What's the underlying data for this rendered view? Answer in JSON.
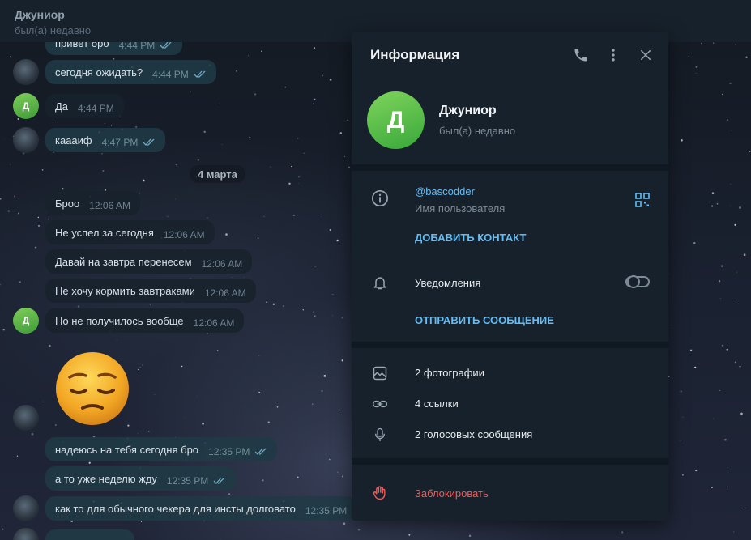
{
  "chat": {
    "title": "Джуниор",
    "status": "был(а) недавно"
  },
  "messages": [
    {
      "text": "привет бро",
      "time": "4:44 PM",
      "dir": "out"
    },
    {
      "text": "сегодня ожидать?",
      "time": "4:44 PM",
      "dir": "out"
    },
    {
      "text": "Да",
      "time": "4:44 PM",
      "dir": "in"
    },
    {
      "text": "каааиф",
      "time": "4:47 PM",
      "dir": "out"
    },
    {
      "text": "Броо",
      "time": "12:06 AM",
      "dir": "in"
    },
    {
      "text": "Не успел за сегодня",
      "time": "12:06 AM",
      "dir": "in"
    },
    {
      "text": "Давай на завтра перенесем",
      "time": "12:06 AM",
      "dir": "in"
    },
    {
      "text": "Не хочу кормить завтраками",
      "time": "12:06 AM",
      "dir": "in"
    },
    {
      "text": "Но не получилось вообще",
      "time": "12:06 AM",
      "dir": "in"
    },
    {
      "text": "надеюсь на тебя сегодня бро",
      "time": "12:35 PM",
      "dir": "out"
    },
    {
      "text": "а то уже неделю жду",
      "time": "12:35 PM",
      "dir": "out"
    },
    {
      "text": "как то для обычного чекера для инсты долговато",
      "time": "12:35 PM",
      "dir": "out"
    }
  ],
  "date_separator": "4 марта",
  "avatar_letter": "Д",
  "panel": {
    "title": "Информация",
    "name": "Джуниор",
    "status": "был(а) недавно",
    "avatar_letter": "Д",
    "username": "@bascodder",
    "username_label": "Имя пользователя",
    "add_contact": "ДОБАВИТЬ КОНТАКТ",
    "notifications": "Уведомления",
    "notifications_enabled": false,
    "send_message": "ОТПРАВИТЬ СООБЩЕНИЕ",
    "photos": "2 фотографии",
    "links": "4 ссылки",
    "voice": "2 голосовых сообщения",
    "block": "Заблокировать"
  },
  "icons": {
    "call": "phone-icon",
    "more": "more-vertical-icon",
    "close": "close-icon",
    "info": "info-icon",
    "qr": "qr-code-icon",
    "bell": "bell-icon",
    "photo": "photo-icon",
    "link": "link-icon",
    "mic": "microphone-icon",
    "block": "hand-stop-icon"
  },
  "colors": {
    "accent": "#62bdf6",
    "danger": "#ef5b5b",
    "panel_bg": "#17212b",
    "avatar_green": "#4cb748"
  }
}
